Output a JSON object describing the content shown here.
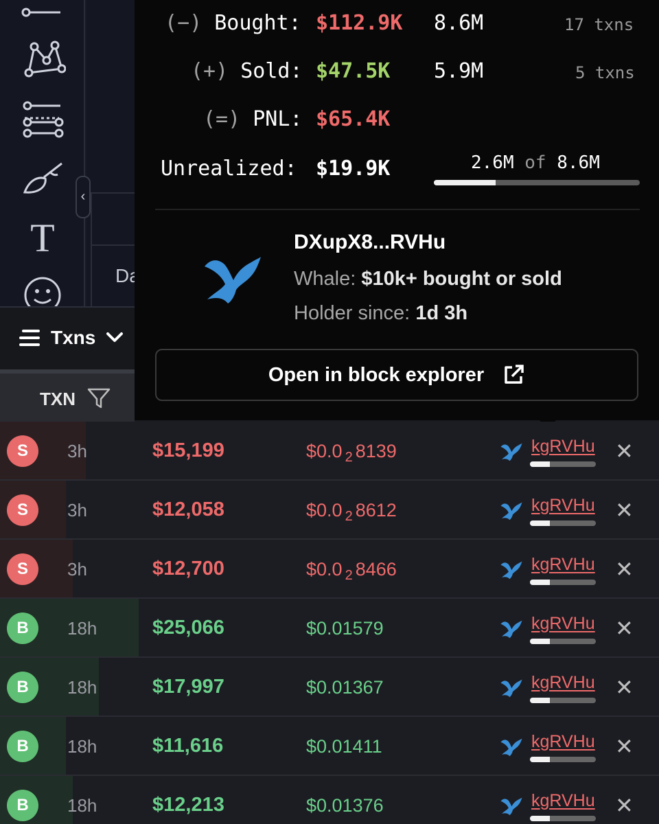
{
  "toolbar": {
    "tools": [
      "menu-lines-icon",
      "pattern-icon",
      "fib-lines-icon",
      "brush-icon",
      "text-icon",
      "emoji-icon"
    ],
    "text_tool_label": "T",
    "collapse_glyph": "‹"
  },
  "chart_partial_text": "Da",
  "txns": {
    "toggle_label": "Txns",
    "column_label": "TXN"
  },
  "popup": {
    "bought": {
      "label": "(−) Bought:",
      "usd": "$112.9K",
      "tokens": "8.6M",
      "txns": "17 txns"
    },
    "sold": {
      "label": "(+) Sold:",
      "usd": "$47.5K",
      "tokens": "5.9M",
      "txns": "5 txns"
    },
    "pnl": {
      "label": "(=) PNL:",
      "usd": "$65.4K"
    },
    "unrealized": {
      "label": "Unrealized:",
      "usd": "$19.9K",
      "held": "2.6M",
      "of": "of",
      "total": "8.6M",
      "fraction": 0.3
    },
    "address": "DXupX8...RVHu",
    "whale_label": "Whale:",
    "whale_value": "$10k+ bought or sold",
    "holder_label": "Holder since:",
    "holder_value": "1d 3h",
    "explorer_button": "Open in block explorer"
  },
  "rows": [
    {
      "type": "S",
      "age": "3h",
      "usd": "$15,199",
      "price_a": "$0.0",
      "price_sub": "2",
      "price_b": "8139",
      "maker": "kgRVHu",
      "amount_fraction": 0.13,
      "maker_fraction": 0.3
    },
    {
      "type": "S",
      "age": "3h",
      "usd": "$12,058",
      "price_a": "$0.0",
      "price_sub": "2",
      "price_b": "8612",
      "maker": "kgRVHu",
      "amount_fraction": 0.1,
      "maker_fraction": 0.3
    },
    {
      "type": "S",
      "age": "3h",
      "usd": "$12,700",
      "price_a": "$0.0",
      "price_sub": "2",
      "price_b": "8466",
      "maker": "kgRVHu",
      "amount_fraction": 0.11,
      "maker_fraction": 0.3
    },
    {
      "type": "B",
      "age": "18h",
      "usd": "$25,066",
      "price_a": "$0.01579",
      "price_sub": "",
      "price_b": "",
      "maker": "kgRVHu",
      "amount_fraction": 0.21,
      "maker_fraction": 0.3
    },
    {
      "type": "B",
      "age": "18h",
      "usd": "$17,997",
      "price_a": "$0.01367",
      "price_sub": "",
      "price_b": "",
      "maker": "kgRVHu",
      "amount_fraction": 0.15,
      "maker_fraction": 0.3
    },
    {
      "type": "B",
      "age": "18h",
      "usd": "$11,616",
      "price_a": "$0.01411",
      "price_sub": "",
      "price_b": "",
      "maker": "kgRVHu",
      "amount_fraction": 0.1,
      "maker_fraction": 0.3
    },
    {
      "type": "B",
      "age": "18h",
      "usd": "$12,213",
      "price_a": "$0.01376",
      "price_sub": "",
      "price_b": "",
      "maker": "kgRVHu",
      "amount_fraction": 0.11,
      "maker_fraction": 0.3
    }
  ],
  "row_close_glyph": "✕",
  "colors": {
    "sell": "#ef6a6a",
    "buy": "#6ad08a",
    "gain": "#a4d36a",
    "whale": "#3b8fd6"
  }
}
